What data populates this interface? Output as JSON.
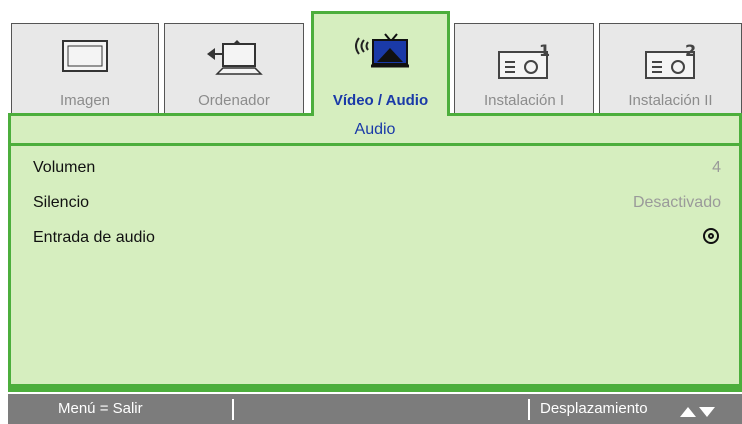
{
  "tabs": [
    {
      "label": "Imagen",
      "icon": "screen-icon",
      "active": false
    },
    {
      "label": "Ordenador",
      "icon": "computer-icon",
      "active": false
    },
    {
      "label": "Vídeo / Audio",
      "icon": "video-audio-icon",
      "active": true
    },
    {
      "label": "Instalación I",
      "icon": "projector-1-icon",
      "active": false
    },
    {
      "label": "Instalación II",
      "icon": "projector-2-icon",
      "active": false
    }
  ],
  "section_title": "Audio",
  "settings": [
    {
      "name": "Volumen",
      "value": "4"
    },
    {
      "name": "Silencio",
      "value": "Desactivado"
    },
    {
      "name": "Entrada de audio",
      "value": "",
      "icon": "enter-icon"
    }
  ],
  "footer": {
    "exit": "Menú = Salir",
    "scroll": "Desplazamiento"
  },
  "colors": {
    "accent_green": "#4cae3c",
    "panel_bg": "#d6eebf",
    "active_label": "#1a3aa8",
    "footer_bg": "#7c7c7c"
  }
}
